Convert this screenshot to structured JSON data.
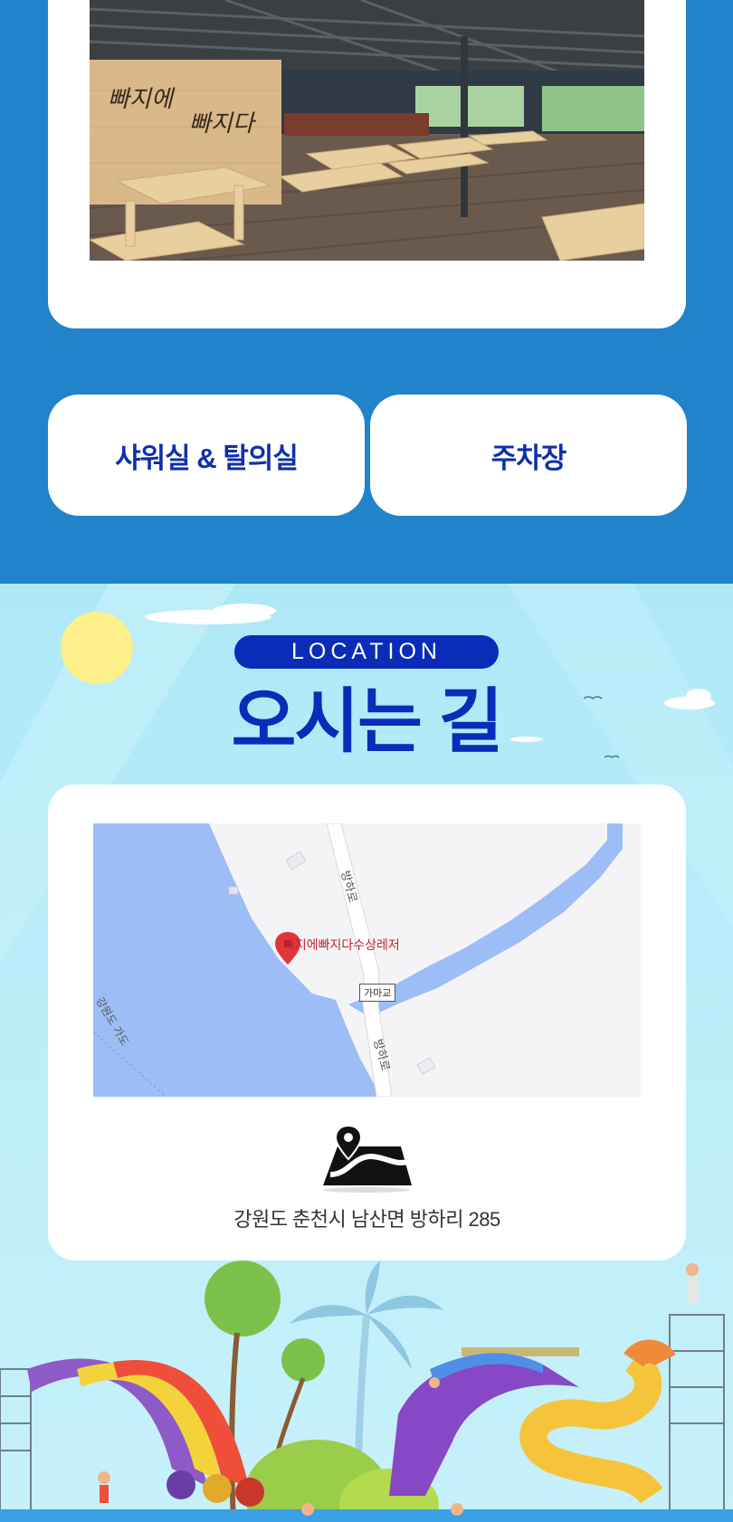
{
  "facility_photo": {
    "sign_text": "빠지에 빠지다"
  },
  "tabs": [
    {
      "label": "샤워실 & 탈의실"
    },
    {
      "label": "주차장"
    }
  ],
  "location": {
    "badge": "LOCATION",
    "title": "오시는 길",
    "map": {
      "place_label": "빠지에빠지다수상레저",
      "road_label_top": "방하로",
      "road_label_bottom": "방하로",
      "bridge_label": "가마교",
      "road_label_left": "강원도 가도"
    },
    "route_icon": "map-route-pin-icon",
    "address": "강원도 춘천시 남산면 방하리 285"
  },
  "colors": {
    "top_background": "#2183c9",
    "accent_blue": "#0b2cb8",
    "tab_text": "#1030a8",
    "sky": "#aee8f7"
  }
}
